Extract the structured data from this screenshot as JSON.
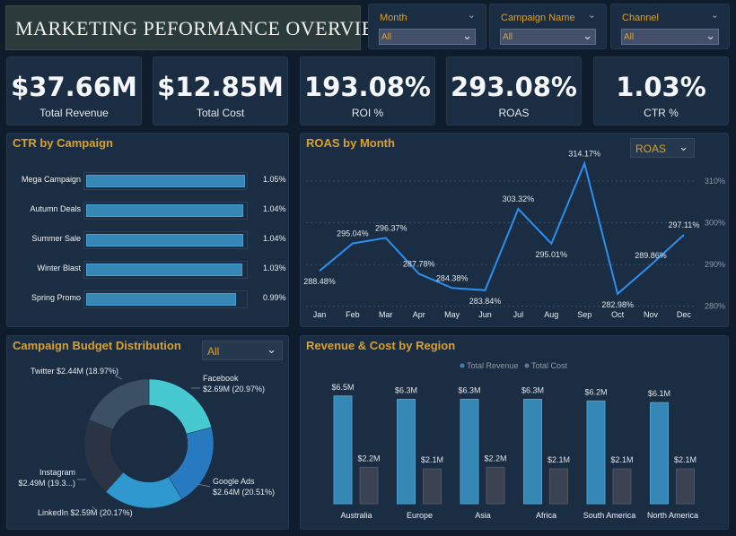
{
  "header": {
    "title": "MARKETING PEFORMANCE OVERVIEW"
  },
  "filters": [
    {
      "label": "Month",
      "value": "All"
    },
    {
      "label": "Campaign Name",
      "value": "All"
    },
    {
      "label": "Channel",
      "value": "All"
    }
  ],
  "kpis": [
    {
      "value": "$37.66M",
      "label": "Total Revenue"
    },
    {
      "value": "$12.85M",
      "label": "Total Cost"
    },
    {
      "value": "193.08%",
      "label": "ROI %"
    },
    {
      "value": "293.08%",
      "label": "ROAS"
    },
    {
      "value": "1.03%",
      "label": "CTR %"
    }
  ],
  "ctr_panel": {
    "title": "CTR by Campaign"
  },
  "roas_panel": {
    "title": "ROAS by Month",
    "dropdown": "ROAS"
  },
  "budget_panel": {
    "title": "Campaign Budget Distribution",
    "dropdown": "All"
  },
  "region_panel": {
    "title": "Revenue & Cost by Region"
  },
  "colors": {
    "accent": "#d9a12b",
    "panel": "#1b2d42",
    "background": "#0f1c2b",
    "bar": "#3587b6",
    "line": "#2b8ff0",
    "cost": "#3b4352"
  },
  "chart_data": [
    {
      "type": "bar",
      "orientation": "horizontal",
      "title": "CTR by Campaign",
      "categories": [
        "Mega Campaign",
        "Autumn Deals",
        "Summer Sale",
        "Winter Blast",
        "Spring Promo"
      ],
      "values": [
        1.05,
        1.04,
        1.04,
        1.03,
        0.99
      ],
      "labels": [
        "1.05%",
        "1.04%",
        "1.04%",
        "1.03%",
        "0.99%"
      ]
    },
    {
      "type": "line",
      "title": "ROAS by Month",
      "x": [
        "Jan",
        "Feb",
        "Mar",
        "Apr",
        "May",
        "Jun",
        "Jul",
        "Aug",
        "Sep",
        "Oct",
        "Nov",
        "Dec"
      ],
      "values": [
        288.48,
        295.04,
        296.37,
        287.78,
        284.38,
        283.84,
        303.32,
        295.01,
        314.17,
        282.98,
        289.86,
        297.11
      ],
      "labels": [
        "288.48%",
        "295.04%",
        "296.37%",
        "287.78%",
        "284.38%",
        "283.84%",
        "303.32%",
        "295.01%",
        "314.17%",
        "282.98%",
        "289.86%",
        "297.11%"
      ],
      "yticks": [
        "280%",
        "290%",
        "300%",
        "310%"
      ],
      "ylim": [
        280,
        315
      ],
      "grid": true
    },
    {
      "type": "pie",
      "title": "Campaign Budget Distribution",
      "donut": true,
      "slices": [
        {
          "name": "Facebook",
          "value": 2.69,
          "label": "Facebook",
          "sublabel": "$2.69M (20.97%)",
          "color": "#47c9d1"
        },
        {
          "name": "Google Ads",
          "value": 2.64,
          "label": "Google Ads",
          "sublabel": "$2.64M (20.51%)",
          "color": "#2779c0"
        },
        {
          "name": "LinkedIn",
          "value": 2.59,
          "label": "LinkedIn $2.59M (20.17%)",
          "sublabel": "",
          "color": "#2f98cf"
        },
        {
          "name": "Instagram",
          "value": 2.49,
          "label": "Instagram",
          "sublabel": "$2.49M (19.3...)",
          "color": "#2a3444"
        },
        {
          "name": "Twitter",
          "value": 2.44,
          "label": "Twitter $2.44M (18.97%)",
          "sublabel": "",
          "color": "#3b5064"
        }
      ]
    },
    {
      "type": "bar",
      "title": "Revenue & Cost by Region",
      "categories": [
        "Australia",
        "Europe",
        "Asia",
        "Africa",
        "South America",
        "North America"
      ],
      "series": [
        {
          "name": "Total Revenue",
          "values": [
            6.5,
            6.3,
            6.3,
            6.3,
            6.2,
            6.1
          ],
          "labels": [
            "$6.5M",
            "$6.3M",
            "$6.3M",
            "$6.3M",
            "$6.2M",
            "$6.1M"
          ],
          "color": "#3587b6"
        },
        {
          "name": "Total Cost",
          "values": [
            2.2,
            2.1,
            2.2,
            2.1,
            2.1,
            2.1
          ],
          "labels": [
            "$2.2M",
            "$2.1M",
            "$2.2M",
            "$2.1M",
            "$2.1M",
            "$2.1M"
          ],
          "color": "#3b4352"
        }
      ],
      "legend": "top"
    }
  ]
}
